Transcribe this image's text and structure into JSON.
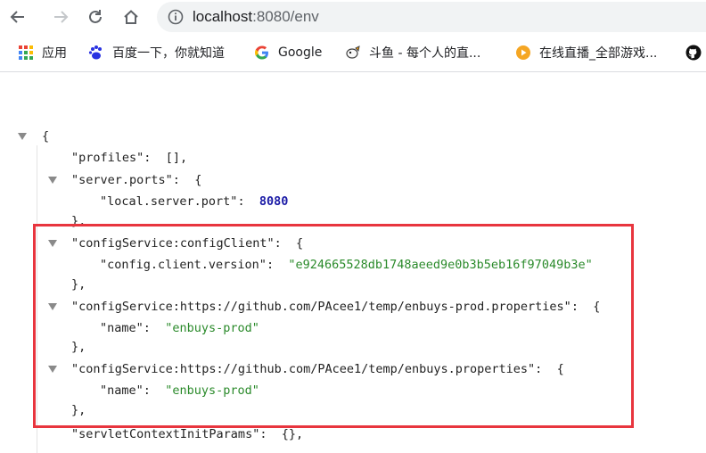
{
  "toolbar": {
    "url_host": "localhost",
    "url_rest": ":8080/env"
  },
  "bookmarks": [
    {
      "label": "应用",
      "icon": "apps-grid-icon"
    },
    {
      "label": "百度一下，你就知道",
      "icon": "baidu-paw-icon"
    },
    {
      "label": "Google",
      "icon": "google-g-icon"
    },
    {
      "label": "斗鱼 - 每个人的直...",
      "icon": "douyu-fish-icon"
    },
    {
      "label": "在线直播_全部游戏...",
      "icon": "live-stream-icon"
    },
    {
      "label": "",
      "icon": "github-icon"
    }
  ],
  "json": {
    "open_brace": "{",
    "profiles_key": "\"profiles\"",
    "profiles_val": "[],",
    "server_ports_key": "\"server.ports\"",
    "obj_open": "{",
    "local_port_key": "\"local.server.port\"",
    "local_port_val": "8080",
    "obj_close": "},",
    "config_client_key": "\"configService:configClient\"",
    "client_version_key": "\"config.client.version\"",
    "client_version_val": "\"e924665528db1748aeed9e0b3b5eb16f97049b3e\"",
    "prod_props_key": "\"configService:https://github.com/PAcee1/temp/enbuys-prod.properties\"",
    "name_key": "\"name\"",
    "prod_name_val": "\"enbuys-prod\"",
    "enbuys_props_key": "\"configService:https://github.com/PAcee1/temp/enbuys.properties\"",
    "enbuys_name_val": "\"enbuys-prod\"",
    "servlet_key": "\"servletContextInitParams\"",
    "servlet_val": "{},",
    "colon": ":"
  },
  "colors": {
    "highlight_border": "#e8353e",
    "string_value": "#2a8a2a",
    "number_value": "#1a1aa6"
  }
}
